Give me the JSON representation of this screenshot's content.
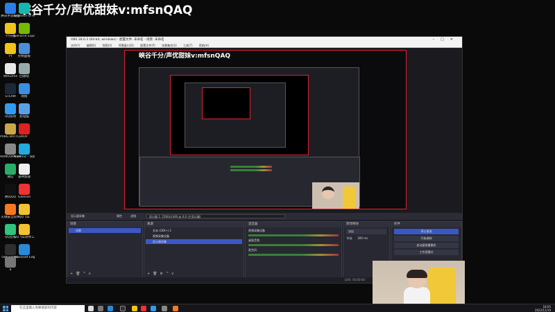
{
  "overlay": {
    "stream_title": "峡谷千分/声优甜妹v:mfsnQAQ"
  },
  "desktop_icons": [
    {
      "label": "腾讯手游助手",
      "color": "#2b7de9"
    },
    {
      "label": "Logitech G HUB",
      "color": "#14b8b0"
    },
    {
      "label": "YY开播",
      "color": "#f0c419"
    },
    {
      "label": "GeForce Experience",
      "color": "#76b900"
    },
    {
      "label": "YY",
      "color": "#f0c419"
    },
    {
      "label": "控制面板",
      "color": "#4a90d9"
    },
    {
      "label": "WeGame",
      "color": "#e8e8e8"
    },
    {
      "label": "回收站",
      "color": "#9aa"
    },
    {
      "label": "STEAM",
      "color": "#1b2838"
    },
    {
      "label": "网络",
      "color": "#3b8fe0"
    },
    {
      "label": "QQ游戏",
      "color": "#2f9cf0"
    },
    {
      "label": "此电脑",
      "color": "#5aa0e8"
    },
    {
      "label": "PUBG BATTLEGR...",
      "color": "#c9a64a"
    },
    {
      "label": "KOV",
      "color": "#d22"
    },
    {
      "label": "ARMOURY CRATE",
      "color": "#888"
    },
    {
      "label": "Nahimic - 快捷方式",
      "color": "#2ad"
    },
    {
      "label": "微信",
      "color": "#2aae67"
    },
    {
      "label": "雷神加速",
      "color": "#eee"
    },
    {
      "label": "腾讯QQ",
      "color": "#111"
    },
    {
      "label": "GeeGee",
      "color": "#e33"
    },
    {
      "label": "火绒安全软件",
      "color": "#f47920"
    },
    {
      "label": "QQ飞车",
      "color": "#f2c230"
    },
    {
      "label": "QQ音乐",
      "color": "#31c27c"
    },
    {
      "label": "QQ飞车转界工具",
      "color": "#f2c230"
    },
    {
      "label": "OBS Studio",
      "color": "#302e31"
    },
    {
      "label": "Microsoft Edge",
      "color": "#2a8ad7"
    },
    {
      "label": "6",
      "color": "#777"
    }
  ],
  "obs": {
    "title": "OBS 28.0.3 (64-bit, windows) - 配置文件: 未命名 - 场景: 未命名",
    "menu": [
      "文件(F)",
      "编辑(E)",
      "视图(V)",
      "停靠窗口(D)",
      "配置文件(P)",
      "场景集合(S)",
      "工具(T)",
      "帮助(H)"
    ],
    "preview_title": "峡谷千分/声优甜妹v:mfsnQAQ",
    "control_strip": {
      "source_name": "显示器采集",
      "props_label": "属性",
      "filter_label": "滤镜",
      "field_label": "显示器 1: 2560x1440 @ 0,0 (主显示器)"
    },
    "scenes": {
      "header": "场景",
      "items": [
        "场景"
      ]
    },
    "sources": {
      "header": "来源",
      "items": [
        "文本 (GDI+) 2",
        "视频采集设备",
        "显示器采集"
      ]
    },
    "mixer": {
      "header": "混音器",
      "channels": [
        {
          "name": "视频采集设备"
        },
        {
          "name": "桌面音频"
        },
        {
          "name": "麦克风"
        }
      ]
    },
    "transitions": {
      "header": "转场特效",
      "type": "淡出",
      "duration_label": "时长",
      "duration": "300 ms"
    },
    "controls": {
      "header": "控件",
      "buttons": [
        "停止推流",
        "开始录制",
        "启动虚拟摄像机",
        "工作室模式"
      ]
    },
    "status": "LIVE: 00:00:00"
  },
  "taskbar": {
    "search_placeholder": "在这里输入你要搜索的内容",
    "time": "18:05",
    "date": "2022/11/19"
  }
}
